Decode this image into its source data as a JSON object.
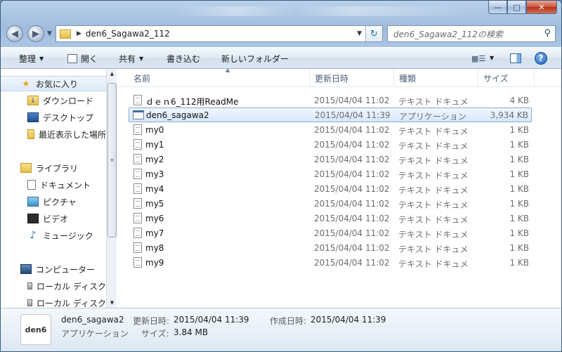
{
  "window": {
    "caption_buttons": [
      "minimize",
      "maximize",
      "close"
    ]
  },
  "address_bar": {
    "path": "den6_Sagawa2_112",
    "search_placeholder": "den6_Sagawa2_112の検索"
  },
  "toolbar": {
    "organize": "整理",
    "open": "開く",
    "share": "共有",
    "burn": "書き込む",
    "new_folder": "新しいフォルダー"
  },
  "sidebar": {
    "items": [
      {
        "label": "お気に入り",
        "icon": "star-icon"
      },
      {
        "label": "ダウンロード",
        "icon": "download-folder-icon"
      },
      {
        "label": "デスクトップ",
        "icon": "desktop-icon"
      },
      {
        "label": "最近表示した場所",
        "icon": "recent-places-icon"
      },
      {
        "label": "ライブラリ",
        "icon": "library-icon"
      },
      {
        "label": "ドキュメント",
        "icon": "documents-icon"
      },
      {
        "label": "ピクチャ",
        "icon": "pictures-icon"
      },
      {
        "label": "ビデオ",
        "icon": "video-icon"
      },
      {
        "label": "ミュージック",
        "icon": "music-icon"
      },
      {
        "label": "コンピューター",
        "icon": "computer-icon"
      },
      {
        "label": "ローカル ディスク",
        "icon": "disk-icon"
      },
      {
        "label": "ローカル ディスク",
        "icon": "disk-icon"
      }
    ]
  },
  "columns": {
    "name": "名前",
    "date": "更新日時",
    "type": "種類",
    "size": "サイズ"
  },
  "files": [
    {
      "name": "ｄｅｎ6_112用ReadMe",
      "date": "2015/04/04 11:02",
      "type": "テキスト ドキュメント",
      "size": "4 KB"
    },
    {
      "name": "den6_sagawa2",
      "date": "2015/04/04 11:39",
      "type": "アプリケーション",
      "size": "3,934 KB"
    },
    {
      "name": "my0",
      "date": "2015/04/04 11:02",
      "type": "テキスト ドキュメント",
      "size": "1 KB"
    },
    {
      "name": "my1",
      "date": "2015/04/04 11:02",
      "type": "テキスト ドキュメント",
      "size": "1 KB"
    },
    {
      "name": "my2",
      "date": "2015/04/04 11:02",
      "type": "テキスト ドキュメント",
      "size": "1 KB"
    },
    {
      "name": "my3",
      "date": "2015/04/04 11:02",
      "type": "テキスト ドキュメント",
      "size": "1 KB"
    },
    {
      "name": "my4",
      "date": "2015/04/04 11:02",
      "type": "テキスト ドキュメント",
      "size": "1 KB"
    },
    {
      "name": "my5",
      "date": "2015/04/04 11:02",
      "type": "テキスト ドキュメント",
      "size": "1 KB"
    },
    {
      "name": "my6",
      "date": "2015/04/04 11:02",
      "type": "テキスト ドキュメント",
      "size": "1 KB"
    },
    {
      "name": "my7",
      "date": "2015/04/04 11:02",
      "type": "テキスト ドキュメント",
      "size": "1 KB"
    },
    {
      "name": "my8",
      "date": "2015/04/04 11:02",
      "type": "テキスト ドキュメント",
      "size": "1 KB"
    },
    {
      "name": "my9",
      "date": "2015/04/04 11:02",
      "type": "テキスト ドキュメント",
      "size": "1 KB"
    }
  ],
  "details_pane": {
    "thumbnail_text": "den6",
    "name": "den6_sagawa2",
    "modified_label": "更新日時:",
    "modified_value": "2015/04/04 11:39",
    "created_label": "作成日時:",
    "created_value": "2015/04/04 11:39",
    "type": "アプリケーション",
    "size_label": "サイズ:",
    "size_value": "3.84 MB"
  },
  "colors": {
    "selection_border": "#84acdd",
    "window_frame": "#a9c4e4",
    "close_button": "#c9523a"
  }
}
